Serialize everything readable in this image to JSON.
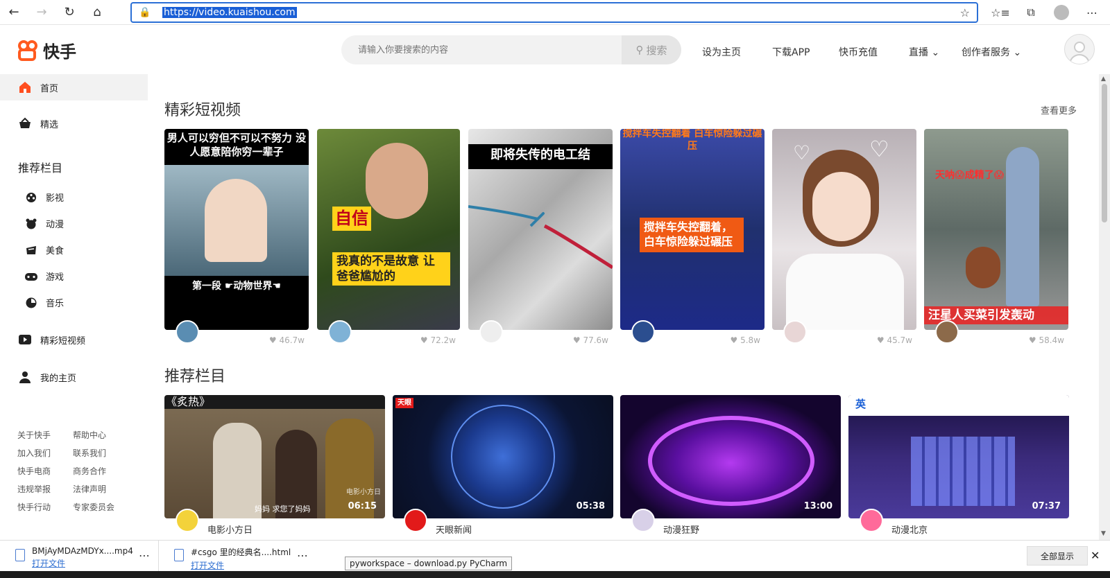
{
  "browser": {
    "url": "https://video.kuaishou.com"
  },
  "header": {
    "logo_text": "快手",
    "search_placeholder": "请输入你要搜索的内容",
    "search_button": "搜索",
    "links": [
      "设为主页",
      "下载APP",
      "快币充值",
      "直播",
      "创作者服务"
    ]
  },
  "sidebar": {
    "home": "首页",
    "featured": "精选",
    "rec_heading": "推荐栏目",
    "categories": [
      "影视",
      "动漫",
      "美食",
      "游戏",
      "音乐"
    ],
    "short_videos": "精彩短视频",
    "my_home": "我的主页",
    "footer_links": [
      "关于快手",
      "帮助中心",
      "加入我们",
      "联系我们",
      "快手电商",
      "商务合作",
      "违规举报",
      "法律声明",
      "快手行动",
      "专家委员会"
    ]
  },
  "main": {
    "short_title": "精彩短视频",
    "see_more": "查看更多",
    "short_videos": [
      {
        "caption_top": "男人可以穷但不可以不努力 没人愿意陪你穷一辈子",
        "caption_bottom": "第一段 ☛动物世界☚",
        "likes": "46.7w"
      },
      {
        "caption_top": "自信",
        "caption_bottom": "我真的不是故意 让爸爸尴尬的",
        "likes": "72.2w"
      },
      {
        "caption_top": "即将失传的电工结",
        "caption_bottom": "",
        "likes": "77.6w"
      },
      {
        "caption_top": "搅拌车失控翻着 白车惊险躲过碾压",
        "caption_bottom": "搅拌车失控翻着，白车惊险躲过碾压",
        "likes": "5.8w"
      },
      {
        "caption_top": "",
        "caption_bottom": "",
        "likes": "45.7w"
      },
      {
        "caption_top": "天呐😱成精了😱",
        "caption_bottom": "汪星人买菜引发轰动",
        "likes": "58.4w"
      }
    ],
    "rec_title": "推荐栏目",
    "rec_videos": [
      {
        "overlay": "《炙热》",
        "duration": "06:15",
        "subtitle": "妈妈 求您了妈妈",
        "watermark": "电影小方日",
        "channel": "电影小方日"
      },
      {
        "overlay": "天眼",
        "duration": "05:38",
        "channel": "天眼新闻"
      },
      {
        "overlay": "",
        "duration": "13:00",
        "channel": "动漫狂野"
      },
      {
        "overlay": "英",
        "duration": "07:37",
        "channel": "动漫北京"
      }
    ]
  },
  "downloads": [
    {
      "name": "BMjAyMDAzMDYx....mp4",
      "action": "打开文件"
    },
    {
      "name": "#csgo 里的经典名....html",
      "action": "打开文件"
    }
  ],
  "download_show_all": "全部显示",
  "tooltip": "pyworkspace – download.py PyCharm"
}
